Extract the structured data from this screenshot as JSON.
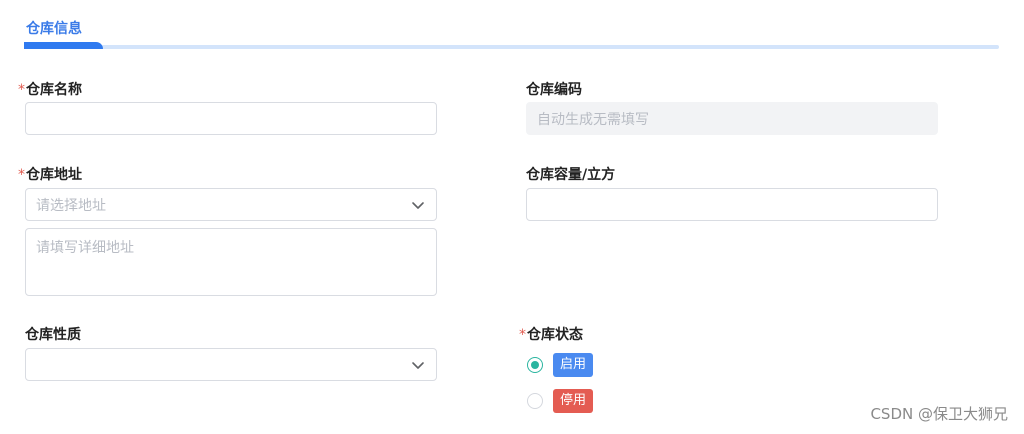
{
  "section": {
    "tab_label": "仓库信息"
  },
  "fields": {
    "name": {
      "label": "仓库名称",
      "required": "*",
      "value": ""
    },
    "code": {
      "label": "仓库编码",
      "placeholder": "自动生成无需填写"
    },
    "address": {
      "label": "仓库地址",
      "required": "*",
      "select_placeholder": "请选择地址",
      "detail_placeholder": "请填写详细地址"
    },
    "capacity": {
      "label": "仓库容量/立方",
      "value": ""
    },
    "nature": {
      "label": "仓库性质",
      "value": ""
    },
    "status": {
      "label": "仓库状态",
      "required": "*",
      "options": [
        {
          "label": "启用",
          "checked": true,
          "color": "#4a8af0"
        },
        {
          "label": "停用",
          "checked": false,
          "color": "#e45c52"
        }
      ]
    }
  },
  "icons": {
    "select_arrow": "chevron-down-icon",
    "radio": "radio-icon"
  },
  "colors": {
    "accent": "#2f7af0",
    "radio_checked": "#2bb5a0",
    "required": "#e05a4f"
  },
  "watermark": "CSDN @保卫大狮兄"
}
